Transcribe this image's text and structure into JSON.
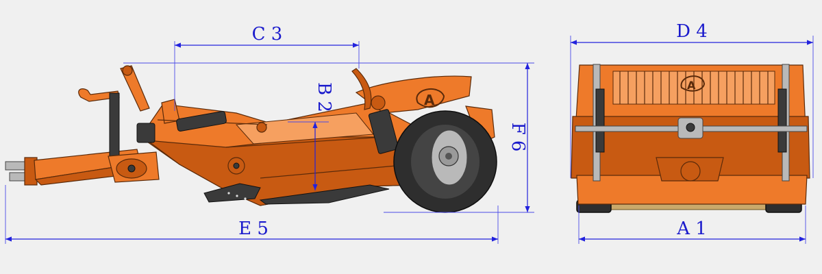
{
  "colors": {
    "dimension_lines": "#2222dd",
    "dimension_text": "#1a1acc",
    "body_orange": "#ee7a2a",
    "body_orange_dark": "#c85a12",
    "tire": "#2e2e2e",
    "background": "#f0f0f0"
  },
  "dimensions": {
    "C": "C 3",
    "B": "B 2",
    "E": "E 5",
    "F": "F 6",
    "D": "D 4",
    "A": "A 1"
  },
  "logo": "A"
}
